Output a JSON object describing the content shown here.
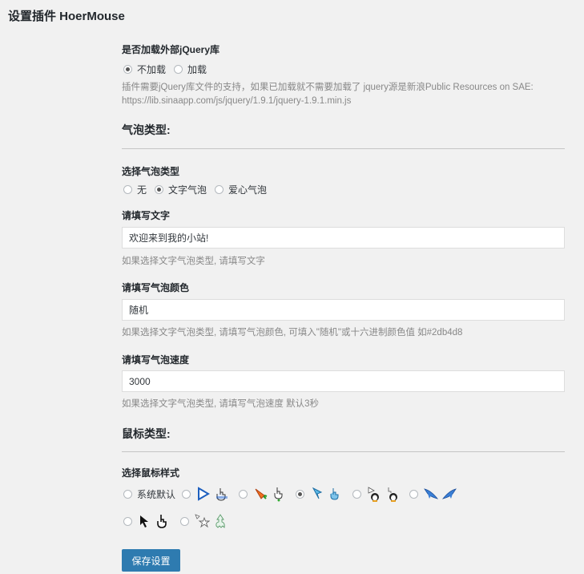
{
  "page_title": "设置插件 HoerMouse",
  "jquery": {
    "label": "是否加载外部jQuery库",
    "options": [
      "不加载",
      "加载"
    ],
    "selected": "不加载",
    "desc_line1": "插件需要jQuery库文件的支持，如果已加载就不需要加载了 jquery源是新浪Public Resources on SAE:",
    "desc_line2": "https://lib.sinaapp.com/js/jquery/1.9.1/jquery-1.9.1.min.js"
  },
  "bubble_section": {
    "title": "气泡类型:",
    "type_label": "选择气泡类型",
    "type_options": [
      "无",
      "文字气泡",
      "爱心气泡"
    ],
    "type_selected": "文字气泡",
    "text_label": "请填写文字",
    "text_value": "欢迎来到我的小站!",
    "text_desc": "如果选择文字气泡类型, 请填写文字",
    "color_label": "请填写气泡颜色",
    "color_value": "随机",
    "color_desc": "如果选择文字气泡类型, 请填写气泡颜色, 可填入\"随机\"或十六进制颜色值 如#2db4d8",
    "speed_label": "请填写气泡速度",
    "speed_value": "3000",
    "speed_desc": "如果选择文字气泡类型, 请填写气泡速度 默认3秒"
  },
  "mouse_section": {
    "title": "鼠标类型:",
    "style_label": "选择鼠标样式",
    "default_option": "系统默认",
    "selected_index": 3,
    "cursor_sets": [
      [
        "triangle-cursor-icon",
        "hand-cursor-icon"
      ],
      [
        "carrot-cursor-icon",
        "green-hand-cursor-icon"
      ],
      [
        "blue-arrow-cursor-icon",
        "blue-hand-cursor-icon"
      ],
      [
        "penguin-arrow-cursor-icon",
        "penguin-hand-cursor-icon"
      ],
      [
        "shark-arrow-cursor-icon",
        "shark-hand-cursor-icon"
      ],
      [
        "black-arrow-cursor-icon",
        "black-hand-cursor-icon"
      ],
      [
        "star-arrow-cursor-icon",
        "ghost-cursor-icon"
      ]
    ]
  },
  "save_button": "保存设置",
  "colors": {
    "accent": "#2e7bb0",
    "background": "#f1f1f1"
  }
}
